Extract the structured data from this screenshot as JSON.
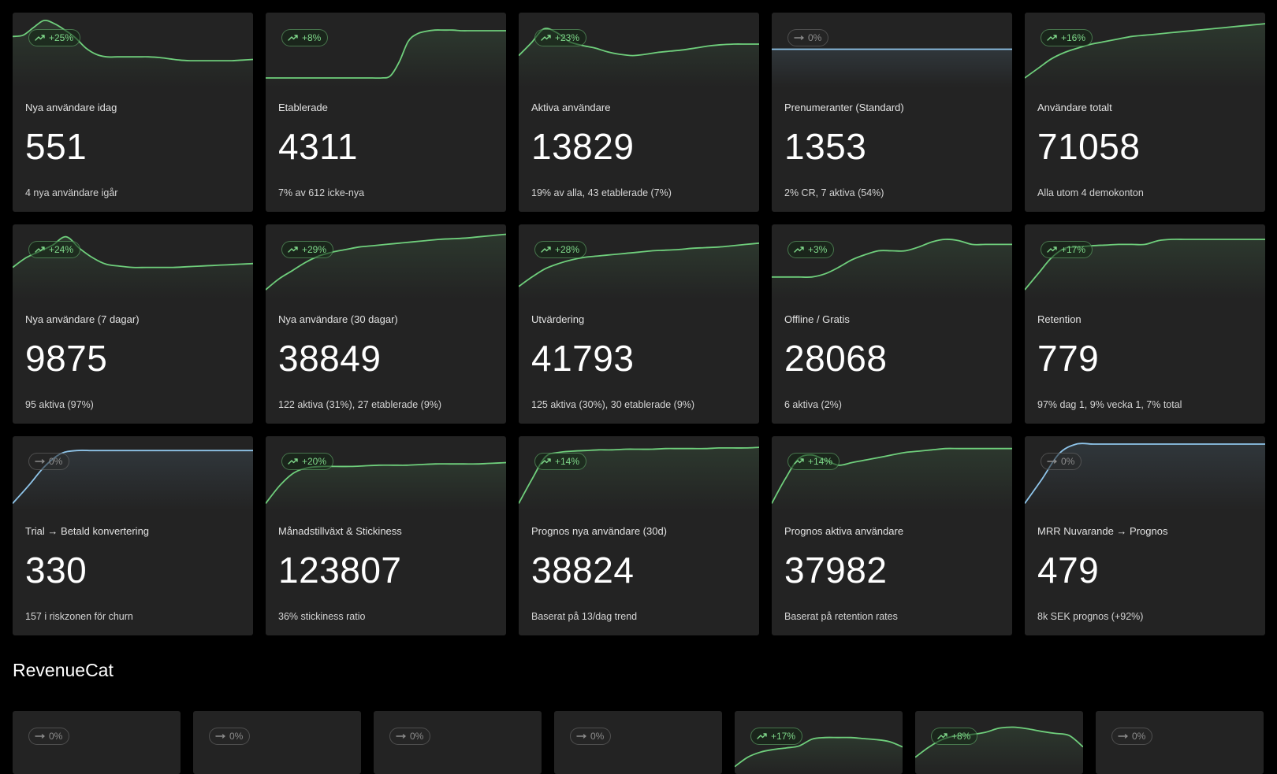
{
  "cards": [
    {
      "label": "Nya användare idag",
      "value": "551",
      "sub": "4 nya användare igår",
      "badge": "+25%",
      "trend": "up",
      "spark": [
        70,
        72,
        84,
        95,
        90,
        80,
        68,
        52,
        42,
        38,
        38,
        38,
        38,
        38,
        37,
        35,
        33,
        32,
        32,
        32,
        32,
        32,
        33,
        34
      ]
    },
    {
      "label": "Etablerade",
      "value": "4311",
      "sub": "7% av 612 icke-nya",
      "badge": "+8%",
      "trend": "up",
      "spark": [
        5,
        5,
        5,
        5,
        5,
        5,
        5,
        5,
        5,
        5,
        5,
        5,
        5,
        5,
        8,
        30,
        62,
        74,
        78,
        80,
        80,
        80,
        79,
        79,
        79,
        79,
        79,
        79
      ]
    },
    {
      "label": "Aktiva användare",
      "value": "13829",
      "sub": "19% av alla, 43 etablerade (7%)",
      "badge": "+23%",
      "trend": "up",
      "spark": [
        40,
        60,
        82,
        76,
        62,
        56,
        52,
        46,
        42,
        40,
        42,
        45,
        47,
        49,
        52,
        55,
        57,
        58,
        58,
        58
      ]
    },
    {
      "label": "Prenumeranter (Standard)",
      "value": "1353",
      "sub": "2% CR, 7 aktiva (54%)",
      "badge": "0%",
      "trend": "flat",
      "spark": [
        50,
        50,
        50,
        50,
        50,
        50,
        50,
        50,
        50,
        50
      ]
    },
    {
      "label": "Användare totalt",
      "value": "71058",
      "sub": "Alla utom 4 demokonton",
      "badge": "+16%",
      "trend": "up",
      "spark": [
        5,
        20,
        35,
        45,
        52,
        58,
        62,
        66,
        70,
        72,
        74,
        76,
        78,
        80,
        82,
        84,
        86,
        88,
        90
      ]
    },
    {
      "label": "Nya användare (7 dagar)",
      "value": "9875",
      "sub": "95 aktiva (97%)",
      "badge": "+24%",
      "trend": "up",
      "spark": [
        40,
        55,
        65,
        75,
        88,
        70,
        55,
        45,
        42,
        40,
        40,
        40,
        40,
        41,
        42,
        43,
        44,
        45,
        46
      ]
    },
    {
      "label": "Nya användare (30 dagar)",
      "value": "38849",
      "sub": "122 aktiva (31%), 27 etablerade (9%)",
      "badge": "+29%",
      "trend": "up",
      "spark": [
        5,
        22,
        35,
        48,
        58,
        64,
        68,
        72,
        74,
        76,
        78,
        80,
        82,
        84,
        85,
        86,
        88,
        90,
        92
      ]
    },
    {
      "label": "Utvärdering",
      "value": "41793",
      "sub": "125 aktiva (30%), 30 etablerade (9%)",
      "badge": "+28%",
      "trend": "up",
      "spark": [
        10,
        25,
        38,
        46,
        52,
        56,
        58,
        60,
        62,
        64,
        66,
        67,
        68,
        70,
        71,
        72,
        74,
        76,
        78
      ]
    },
    {
      "label": "Offline / Gratis",
      "value": "28068",
      "sub": "6 aktiva (2%)",
      "badge": "+3%",
      "trend": "up",
      "spark": [
        25,
        25,
        25,
        25,
        30,
        40,
        52,
        60,
        66,
        66,
        66,
        72,
        80,
        84,
        82,
        76,
        76,
        76,
        76
      ]
    },
    {
      "label": "Retention",
      "value": "779",
      "sub": "97% dag 1, 9% vecka 1, 7% total",
      "badge": "+17%",
      "trend": "up",
      "spark": [
        5,
        30,
        55,
        70,
        72,
        74,
        75,
        76,
        76,
        76,
        82,
        84,
        84,
        84,
        84,
        84,
        84,
        84,
        84
      ]
    },
    {
      "label": "Trial → Betald konvertering",
      "value": "330",
      "sub": "157 i riskzonen för churn",
      "badge": "0%",
      "trend": "flat",
      "spark": [
        2,
        30,
        60,
        80,
        85,
        85,
        85,
        85,
        85,
        85,
        85,
        85,
        85,
        85,
        85,
        85
      ]
    },
    {
      "label": "Månadstillväxt & Stickiness",
      "value": "123807",
      "sub": "36% stickiness ratio",
      "badge": "+20%",
      "trend": "up",
      "spark": [
        2,
        30,
        50,
        58,
        60,
        60,
        60,
        61,
        62,
        62,
        62,
        63,
        64,
        64,
        64,
        64,
        65,
        66
      ]
    },
    {
      "label": "Prognos nya användare (30d)",
      "value": "38824",
      "sub": "Baserat på 13/dag trend",
      "badge": "+14%",
      "trend": "up",
      "spark": [
        2,
        40,
        75,
        82,
        84,
        85,
        86,
        86,
        87,
        87,
        87,
        88,
        88,
        88,
        88,
        89,
        89,
        89,
        90
      ]
    },
    {
      "label": "Prognos aktiva användare",
      "value": "37982",
      "sub": "Baserat på retention rates",
      "badge": "+14%",
      "trend": "up",
      "spark": [
        2,
        40,
        72,
        78,
        70,
        62,
        66,
        70,
        74,
        78,
        82,
        84,
        86,
        88,
        88,
        88,
        88,
        88,
        88
      ]
    },
    {
      "label": "MRR Nuvarande → Prognos",
      "value": "479",
      "sub": "8k SEK prognos (+92%)",
      "badge": "0%",
      "trend": "flat",
      "spark": [
        2,
        40,
        80,
        95,
        95,
        95,
        95,
        95,
        95,
        95,
        95,
        95,
        95,
        95,
        95
      ]
    }
  ],
  "section": {
    "title": "RevenueCat"
  },
  "revenuecat_cards": [
    {
      "badge": "0%",
      "trend": "flat",
      "spark": []
    },
    {
      "badge": "0%",
      "trend": "flat",
      "spark": []
    },
    {
      "badge": "0%",
      "trend": "flat",
      "spark": []
    },
    {
      "badge": "0%",
      "trend": "flat",
      "spark": []
    },
    {
      "badge": "+17%",
      "trend": "up",
      "spark": [
        2,
        20,
        30,
        35,
        38,
        42,
        55,
        58,
        58,
        58,
        56,
        54,
        50,
        40
      ]
    },
    {
      "badge": "+8%",
      "trend": "up",
      "spark": [
        20,
        40,
        55,
        62,
        64,
        68,
        76,
        78,
        75,
        70,
        66,
        62,
        40
      ]
    },
    {
      "badge": "0%",
      "trend": "flat",
      "spark": []
    }
  ],
  "colors": {
    "up": "#6fcf7c",
    "flat": "#8fc5ea",
    "card": "#232323",
    "background": "#000000"
  },
  "icons": {
    "up": "trending-up-icon",
    "flat": "arrow-right-icon"
  }
}
